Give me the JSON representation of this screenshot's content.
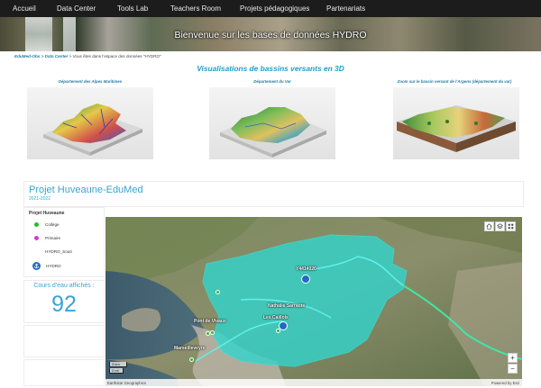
{
  "nav": {
    "items": [
      {
        "label": "Accueil"
      },
      {
        "label": "Data Center"
      },
      {
        "label": "Tools Lab"
      },
      {
        "label": "Teachers Room"
      },
      {
        "label": "Projets pédagogiques"
      },
      {
        "label": "Partenariats"
      }
    ]
  },
  "banner": {
    "title": "Bienvenue sur les bases de données HYDRO"
  },
  "breadcrumb": {
    "link1": "EduMed-Obs",
    "link2": "Data Center",
    "sep": ">",
    "current": "> Vous êtes dans l'espace des données \"HYDRO\""
  },
  "visualisations": {
    "title": "Visualisations de bassins versants en 3D",
    "thumbs": [
      {
        "caption": "Département des Alpes Maritimes"
      },
      {
        "caption": "Département du Var"
      },
      {
        "caption": "Zoom sur le bassin versant de l'Argens (département du var)"
      }
    ]
  },
  "project": {
    "title": "Projet Huveaune-EduMed",
    "years": "2021-2022"
  },
  "legend": {
    "title": "Projet Huveaune",
    "items": [
      {
        "label": "Collège",
        "color": "#2db82d"
      },
      {
        "label": "Primaire",
        "color": "#d63ad6"
      },
      {
        "label": "HYDRO_Souti",
        "color": ""
      },
      {
        "label": "HYDRO",
        "color": "#1f6cc4"
      }
    ]
  },
  "counter": {
    "label": "Cours d'eau affichés :",
    "value": "92"
  },
  "map": {
    "labels": [
      {
        "text": "Y4414020"
      },
      {
        "text": "Nathalie Sarraute"
      },
      {
        "text": "Les Caillols"
      },
      {
        "text": "Pont de Vivaux"
      },
      {
        "text": "Marseilleveyre"
      }
    ],
    "scale": {
      "km": "3 km",
      "mi": "2 mi"
    },
    "attribution_left": "Earthstar Geographics",
    "attribution_right": "Powered by Esri",
    "zoom_in": "+",
    "zoom_out": "−"
  },
  "colors": {
    "accent": "#3aa3d2",
    "link": "#1d7ea8",
    "watershed": "#2fd6cf",
    "nav_bg": "#1c1c1c"
  }
}
